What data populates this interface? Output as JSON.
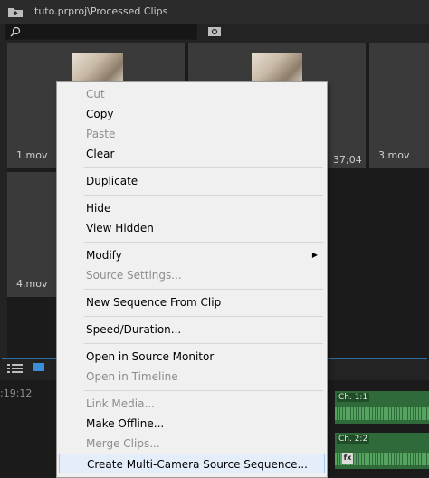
{
  "project_panel": {
    "path": "tuto.prproj\\Processed Clips",
    "search_placeholder": "",
    "clips": [
      {
        "name": "1.mov"
      },
      {
        "name": ""
      },
      {
        "name": "3.mov"
      },
      {
        "name": "4.mov"
      }
    ],
    "clip2_timecode": "37;04"
  },
  "timeline": {
    "timecode": ";19;12",
    "track1_label": "Ch. 1:1",
    "track2_label": "Ch. 2:2",
    "fx_label": "fx"
  },
  "context_menu": {
    "items": [
      {
        "label": "Cut",
        "enabled": false
      },
      {
        "label": "Copy",
        "enabled": true
      },
      {
        "label": "Paste",
        "enabled": false
      },
      {
        "label": "Clear",
        "enabled": true
      },
      {
        "label": "Duplicate",
        "enabled": true
      },
      {
        "label": "Hide",
        "enabled": true
      },
      {
        "label": "View Hidden",
        "enabled": true
      },
      {
        "label": "Modify",
        "enabled": true,
        "submenu": true
      },
      {
        "label": "Source Settings...",
        "enabled": false
      },
      {
        "label": "New Sequence From Clip",
        "enabled": true
      },
      {
        "label": "Speed/Duration...",
        "enabled": true
      },
      {
        "label": "Open in Source Monitor",
        "enabled": true
      },
      {
        "label": "Open in Timeline",
        "enabled": false
      },
      {
        "label": "Link Media...",
        "enabled": false
      },
      {
        "label": "Make Offline...",
        "enabled": true
      },
      {
        "label": "Merge Clips...",
        "enabled": false
      },
      {
        "label": "Create Multi-Camera Source Sequence...",
        "enabled": true,
        "highlighted": true
      }
    ]
  },
  "colors": {
    "accent_blue": "#2d6fa3",
    "menu_bg": "#f0f0f0",
    "track_green": "#2f6b3a"
  }
}
